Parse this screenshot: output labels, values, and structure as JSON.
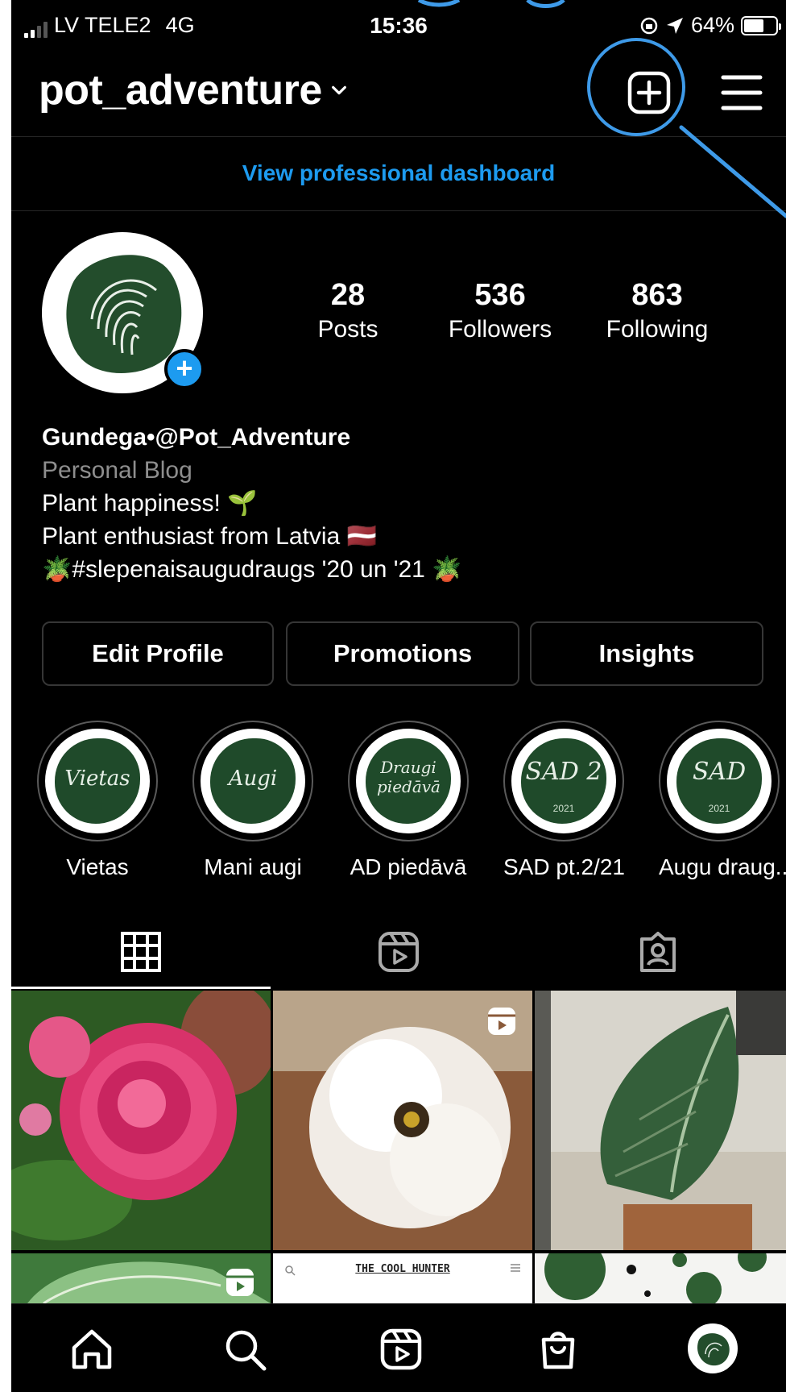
{
  "status_bar": {
    "carrier": "LV TELE2",
    "network": "4G",
    "time": "15:36",
    "battery": "64%",
    "battery_level": 0.64
  },
  "header": {
    "username": "pot_adventure",
    "icons": [
      "chevron-down-icon",
      "new-post-icon",
      "menu-icon"
    ],
    "annotation_color": "#3e9ae8"
  },
  "dashboard_link": "View professional dashboard",
  "profile": {
    "stats": [
      {
        "value": "28",
        "label": "Posts"
      },
      {
        "value": "536",
        "label": "Followers"
      },
      {
        "value": "863",
        "label": "Following"
      }
    ],
    "display_name": "Gundega•@Pot_Adventure",
    "category": "Personal Blog",
    "bio_lines": [
      "Plant happiness! 🌱",
      "Plant enthusiast from Latvia 🇱🇻",
      "🪴#slepenaisaugudraugs  '20 un '21 🪴"
    ]
  },
  "buttons": [
    "Edit Profile",
    "Promotions",
    "Insights"
  ],
  "highlights": [
    {
      "cover_text": "Vietas",
      "cover_sub": "",
      "label": "Vietas"
    },
    {
      "cover_text": "Augi",
      "cover_sub": "",
      "label": "Mani augi"
    },
    {
      "cover_text": "Draugi piedāvā",
      "cover_sub": "",
      "label": "AD piedāvā"
    },
    {
      "cover_text": "SAD 2",
      "cover_sub": "2021",
      "label": "SAD pt.2/21"
    },
    {
      "cover_text": "SAD",
      "cover_sub": "2021",
      "label": "Augu draug..."
    }
  ],
  "tabs": [
    "grid-icon",
    "reels-icon",
    "tagged-icon"
  ],
  "grid_posts": [
    {
      "subject": "pink rose",
      "reel": false
    },
    {
      "subject": "white rose",
      "reel": true
    },
    {
      "subject": "green leaf plant",
      "reel": false
    },
    {
      "subject": "striped leaf",
      "reel": true
    },
    {
      "text": "THE COOL HUNTER",
      "reel": false
    },
    {
      "subject": "green dots pattern",
      "reel": false
    }
  ],
  "bottom_nav": [
    "home-icon",
    "search-icon",
    "reels-icon",
    "shop-icon",
    "profile-avatar"
  ],
  "colors": {
    "background": "#000000",
    "link": "#1d9bf0",
    "muted": "#8e8e8e",
    "border": "#363636"
  }
}
